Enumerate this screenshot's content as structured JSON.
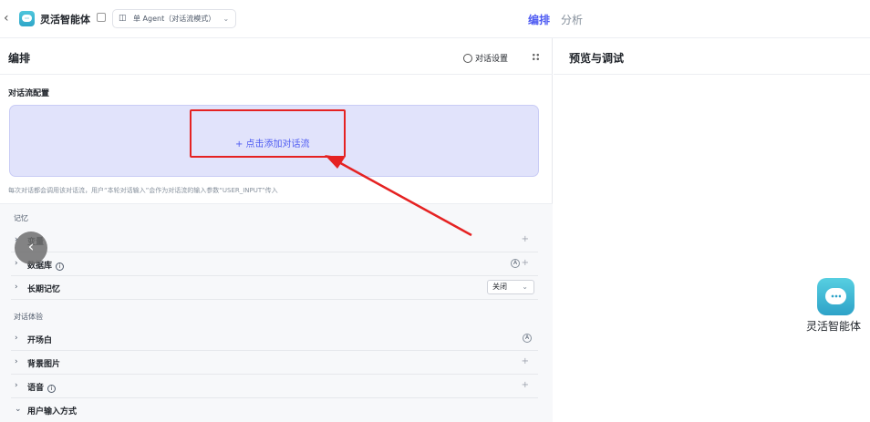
{
  "topbar": {
    "app_name": "灵活智能体",
    "mode_label": "单 Agent（对话流模式）",
    "tab_arrange": "编排",
    "tab_analysis": "分析"
  },
  "left": {
    "title": "编排",
    "dialog_settings": "对话设置",
    "section_flow": "对话流配置",
    "add_flow": "+ 点击添加对话流",
    "flow_hint": "每次对话都会调用该对话流，用户“本轮对话输入”会作为对话流的输入参数“USER_INPUT”传入",
    "group_memory": "记忆",
    "row_variables": "变量",
    "row_database": "数据库",
    "row_longterm": "长期记忆",
    "longterm_value": "关闭",
    "group_experience": "对话体验",
    "row_opening": "开场白",
    "row_background": "背景图片",
    "row_voice": "语音",
    "row_input_mode": "用户输入方式"
  },
  "right": {
    "title": "预览与调试",
    "bot_name": "灵活智能体"
  },
  "colors": {
    "accent": "#4e5bf2",
    "flow_box_bg": "#e1e3fb",
    "highlight_red": "#e52222"
  }
}
